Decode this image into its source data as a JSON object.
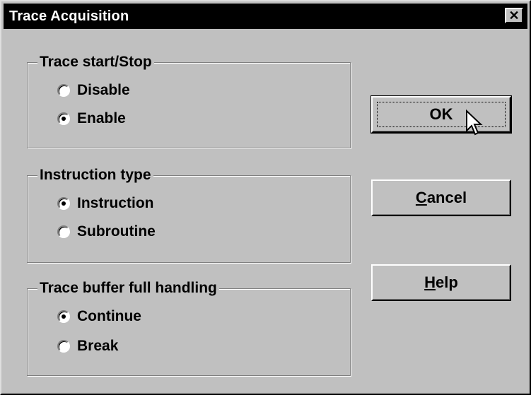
{
  "window": {
    "title": "Trace Acquisition",
    "close_glyph": "✕"
  },
  "groups": {
    "start_stop": {
      "title": "Trace start/Stop",
      "options": [
        {
          "label": "Disable",
          "checked": false
        },
        {
          "label": "Enable",
          "checked": true
        }
      ]
    },
    "instruction_type": {
      "title": "Instruction type",
      "options": [
        {
          "label": "Instruction",
          "checked": true
        },
        {
          "label": "Subroutine",
          "checked": false
        }
      ]
    },
    "buffer_handling": {
      "title": "Trace buffer full handling",
      "options": [
        {
          "label": "Continue",
          "checked": true
        },
        {
          "label": "Break",
          "checked": false
        }
      ]
    }
  },
  "buttons": {
    "ok": {
      "label": "OK"
    },
    "cancel": {
      "mnemonic": "C",
      "rest": "ancel"
    },
    "help": {
      "mnemonic": "H",
      "rest": "elp"
    }
  },
  "icons": {
    "cursor": "arrow-pointer-icon"
  },
  "colors": {
    "face": "#c0c0c0",
    "titlebar": "#000000",
    "title_text": "#ffffff"
  }
}
